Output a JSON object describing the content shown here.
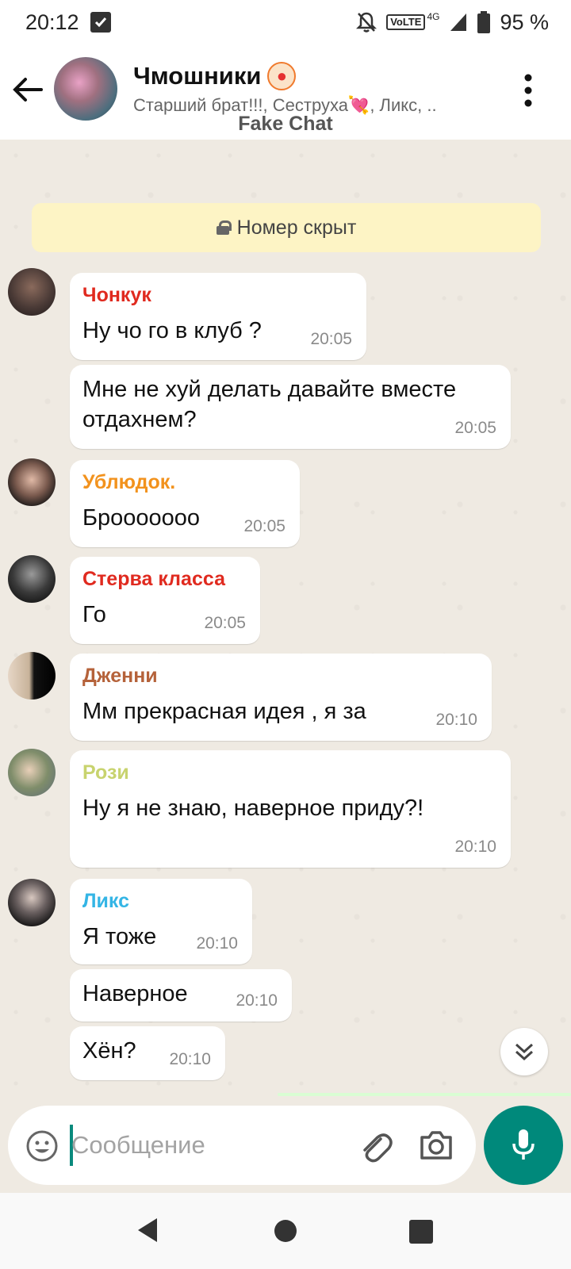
{
  "status_bar": {
    "time": "20:12",
    "network": "VoLTE",
    "network_gen": "4G",
    "battery": "95 %"
  },
  "header": {
    "title": "Чмошники",
    "subtitle": "Старший брат!!!, Сеструха💘, Ликс, ..",
    "watermark": "Fake Chat"
  },
  "notice": {
    "text": "Номер скрыт"
  },
  "messages": [
    {
      "sender": "Чонкук",
      "sender_color": "#e02a1f",
      "text": "Ну чо го в клуб ?",
      "time": "20:05"
    },
    {
      "sender": "",
      "text_line1": "Мне не хуй делать давайте вместе",
      "text_line2": "отдахнем?",
      "time": "20:05"
    },
    {
      "sender": "Ублюдок.",
      "sender_color": "#f2921d",
      "text": "Брооооооо",
      "time": "20:05"
    },
    {
      "sender": "Стерва класса",
      "sender_color": "#e02a1f",
      "text": "Го",
      "time": "20:05"
    },
    {
      "sender": "Дженни",
      "sender_color": "#b5623a",
      "text": "Мм прекрасная идея , я за",
      "time": "20:10"
    },
    {
      "sender": "Рози",
      "sender_color": "#c8d36e",
      "text": "Ну я не знаю, наверное приду?!",
      "time": "20:10"
    },
    {
      "sender": "Ликс",
      "sender_color": "#34b5e5",
      "text": "Я тоже",
      "time": "20:10"
    },
    {
      "sender": "",
      "text": "Наверное",
      "time": "20:10"
    },
    {
      "sender": "",
      "text": "Хён?",
      "time": "20:10"
    }
  ],
  "input": {
    "placeholder": "Сообщение"
  },
  "colors": {
    "accent": "#00897b",
    "chat_bg": "#efeae2",
    "notice_bg": "#fdf4c5"
  }
}
